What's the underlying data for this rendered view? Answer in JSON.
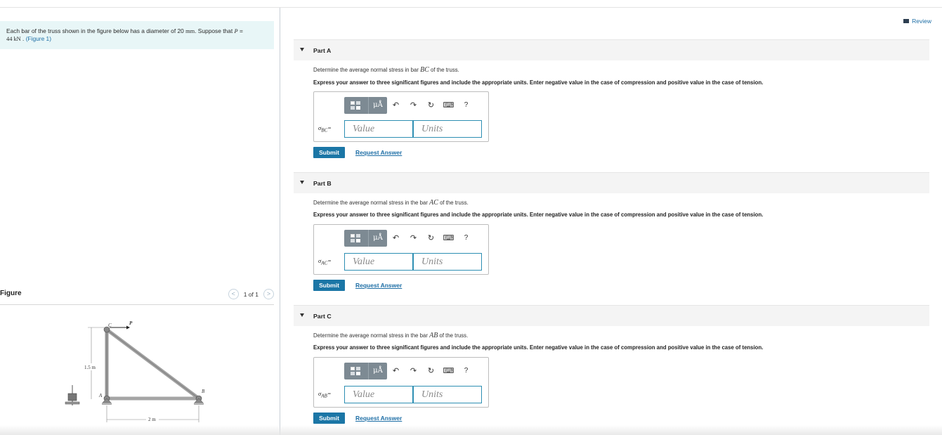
{
  "problem": {
    "text_before": "Each bar of the truss shown in the figure below has a diameter of 20 ",
    "diameter_unit": "mm",
    "text_mid": ". Suppose that ",
    "load_var": "P",
    "text_eq": " =",
    "load_value": "44 kN",
    "text_after": " . ",
    "figure_link": "(Figure 1)"
  },
  "figure": {
    "title": "Figure",
    "pager_prev": "<",
    "pager_count": "1 of 1",
    "pager_next": ">",
    "labels": {
      "node_c": "C",
      "node_a": "A",
      "node_b": "B",
      "load": "P",
      "height": "1.5 m",
      "width": "2 m"
    }
  },
  "header": {
    "review_label": "Review"
  },
  "toolbar": {
    "units_symbol": "μÅ",
    "undo_icon": "↶",
    "redo_icon": "↷",
    "reset_icon": "↻",
    "keyboard_icon": "⌨",
    "help_icon": "?"
  },
  "parts": [
    {
      "title": "Part A",
      "question_before": "Determine the average normal stress in bar ",
      "bar": "BC",
      "question_after": " of the truss.",
      "instructions": "Express your answer to three significant figures and include the appropriate units. Enter negative value in the case of compression and positive value in the case of tension.",
      "symbol": "σ",
      "subscript": "BC",
      "eq": "=",
      "value_placeholder": "Value",
      "units_placeholder": "Units",
      "submit_label": "Submit",
      "request_label": "Request Answer"
    },
    {
      "title": "Part B",
      "question_before": "Determine the average normal stress in the bar ",
      "bar": "AC",
      "question_after": " of the truss.",
      "instructions": "Express your answer to three significant figures and include the appropriate units. Enter negative value in the case of compression and positive value in the case of tension.",
      "symbol": "σ",
      "subscript": "AC",
      "eq": "=",
      "value_placeholder": "Value",
      "units_placeholder": "Units",
      "submit_label": "Submit",
      "request_label": "Request Answer"
    },
    {
      "title": "Part C",
      "question_before": "Determine the average normal stress in the bar ",
      "bar": "AB",
      "question_after": " of the truss.",
      "instructions": "Express your answer to three significant figures and include the appropriate units. Enter negative value in the case of compression and positive value in the case of tension.",
      "symbol": "σ",
      "subscript": "AB",
      "eq": "=",
      "value_placeholder": "Value",
      "units_placeholder": "Units",
      "submit_label": "Submit",
      "request_label": "Request Answer"
    }
  ]
}
